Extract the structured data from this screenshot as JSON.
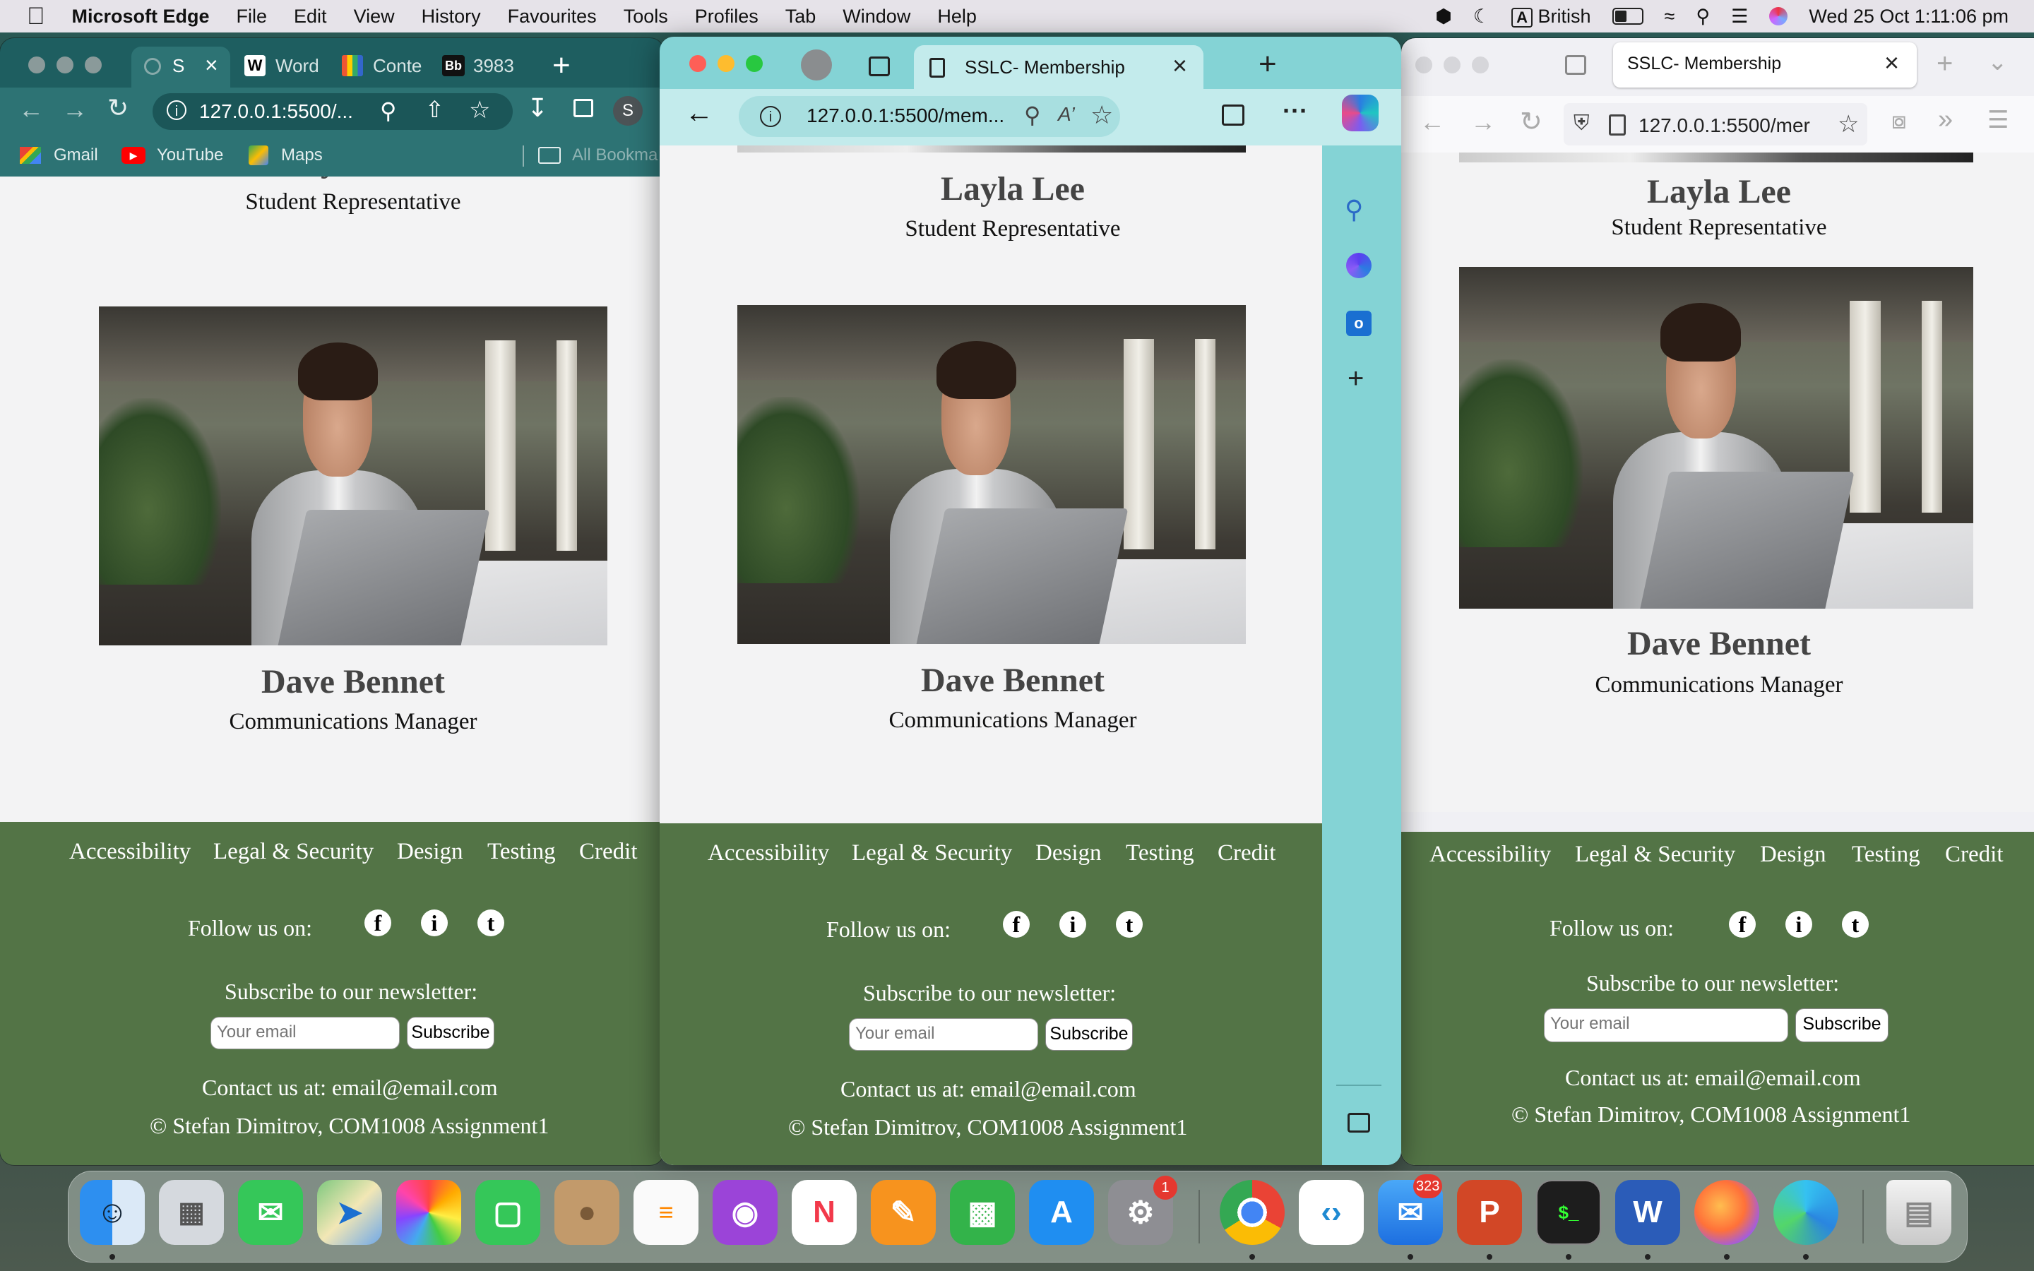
{
  "menubar": {
    "app_name": "Microsoft Edge",
    "items": [
      "File",
      "Edit",
      "View",
      "History",
      "Favourites",
      "Tools",
      "Profiles",
      "Tab",
      "Window",
      "Help"
    ],
    "input_source": "British",
    "datetime": "Wed 25 Oct  1:11:06 pm"
  },
  "left_window": {
    "tabs": [
      {
        "label": "S",
        "icon": "loading-icon"
      },
      {
        "label": "Word",
        "icon": "wordreference-icon"
      },
      {
        "label": "Conte",
        "icon": "analytics-icon"
      },
      {
        "label": "3983",
        "icon": "blackboard-icon"
      }
    ],
    "new_tab": "+",
    "url": "127.0.0.1:5500/...",
    "profile_initial": "S",
    "bookmarks": [
      "Gmail",
      "YouTube",
      "Maps"
    ],
    "all_bookmarks": "All Bookma"
  },
  "middle_window": {
    "tab_title": "SSLC- Membership",
    "url": "127.0.0.1:5500/mem...",
    "menu_dots": "···"
  },
  "right_window": {
    "tab_title": "SSLC- Membership",
    "url": "127.0.0.1:5500/mer"
  },
  "page": {
    "members": [
      {
        "name": "Layla Lee",
        "role": "Student Representative"
      },
      {
        "name": "Dave Bennet",
        "role": "Communications Manager"
      }
    ],
    "footer_nav": [
      "Accessibility",
      "Legal & Security",
      "Design",
      "Testing",
      "Credit"
    ],
    "follow_label": "Follow us on:",
    "social": [
      "f",
      "i",
      "t"
    ],
    "newsletter_label": "Subscribe to our newsletter:",
    "email_placeholder": "Your email",
    "subscribe_label": "Subscribe",
    "contact": "Contact us at: email@email.com",
    "copyright": "© Stefan Dimitrov, COM1008 Assignment1"
  },
  "dock": {
    "apps": [
      "Finder",
      "Launchpad",
      "Messages",
      "Maps",
      "Photos",
      "FaceTime",
      "Contacts",
      "Reminders",
      "Podcasts",
      "News",
      "Pages",
      "Numbers",
      "App Store",
      "System Settings",
      "Google Chrome",
      "Visual Studio Code",
      "Mail",
      "PowerPoint",
      "Terminal",
      "Word",
      "Firefox",
      "Microsoft Edge",
      "Trash"
    ],
    "settings_badge": "1",
    "mail_badge": "323"
  }
}
